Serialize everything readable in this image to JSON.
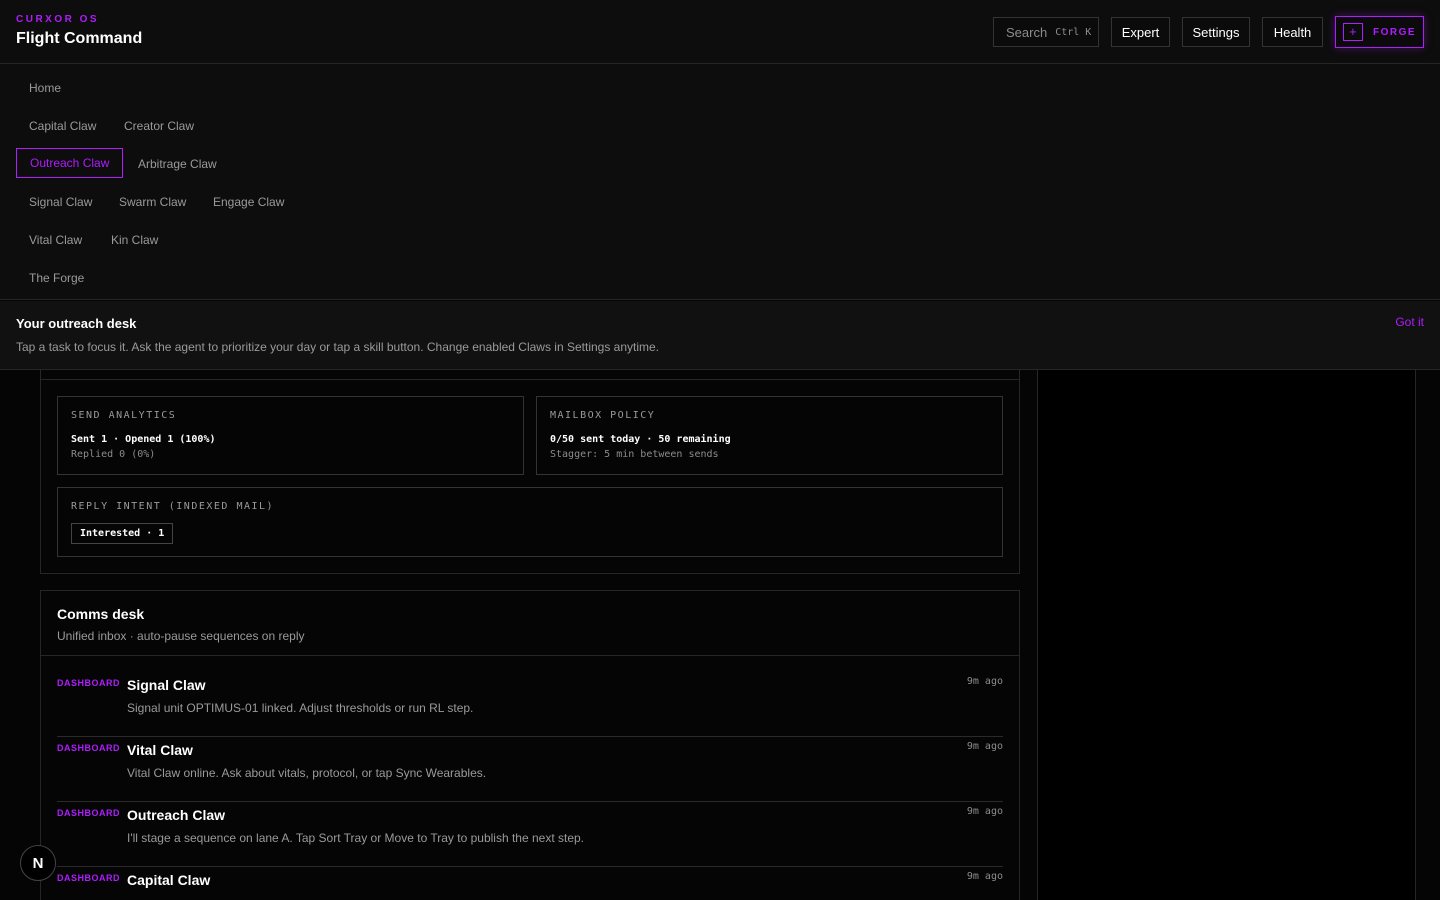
{
  "header": {
    "brand": "CURXOR OS",
    "title": "Flight Command",
    "search_label": "Search",
    "search_shortcut": "Ctrl K",
    "buttons": {
      "expert": "Expert",
      "settings": "Settings",
      "health": "Health",
      "forge": "FORGE",
      "forge_icon": "+"
    }
  },
  "nav": {
    "items": [
      {
        "label": "Home"
      },
      {
        "label": "Capital Claw"
      },
      {
        "label": "Creator Claw"
      },
      {
        "label": "Outreach Claw",
        "active": true
      },
      {
        "label": "Arbitrage Claw"
      },
      {
        "label": "Signal Claw"
      },
      {
        "label": "Swarm Claw"
      },
      {
        "label": "Engage Claw"
      },
      {
        "label": "Vital Claw"
      },
      {
        "label": "Kin Claw"
      },
      {
        "label": "The Forge"
      }
    ]
  },
  "banner": {
    "title": "Your outreach desk",
    "text": "Tap a task to focus it. Ask the agent to prioritize your day or tap a skill button. Change enabled Claws in Settings anytime.",
    "dismiss": "Got it"
  },
  "analytics": {
    "send": {
      "label": "SEND ANALYTICS",
      "line1": "Sent 1 · Opened 1 (100%)",
      "line2": "Replied 0 (0%)"
    },
    "mailbox": {
      "label": "MAILBOX POLICY",
      "line1": "0/50 sent today · 50 remaining",
      "line2": "Stagger: 5 min between sends"
    },
    "intent": {
      "label": "REPLY INTENT (INDEXED MAIL)",
      "chip": "Interested · 1"
    }
  },
  "comms": {
    "title": "Comms desk",
    "subtitle": "Unified inbox · auto-pause sequences on reply",
    "items": [
      {
        "tag": "DASHBOARD",
        "title": "Signal Claw",
        "body": "Signal unit OPTIMUS-01 linked. Adjust thresholds or run RL step.",
        "time": "9m ago"
      },
      {
        "tag": "DASHBOARD",
        "title": "Vital Claw",
        "body": "Vital Claw online. Ask about vitals, protocol, or tap Sync Wearables.",
        "time": "9m ago"
      },
      {
        "tag": "DASHBOARD",
        "title": "Outreach Claw",
        "body": "I'll stage a sequence on lane A. Tap Sort Tray or Move to Tray to publish the next step.",
        "time": "9m ago"
      },
      {
        "tag": "DASHBOARD",
        "title": "Capital Claw",
        "body": "",
        "time": "9m ago"
      }
    ]
  },
  "badge": {
    "letter": "N"
  },
  "colors": {
    "accent": "#b01cff",
    "background": "#050505",
    "surface": "#0d0d0d",
    "border": "#262626"
  }
}
